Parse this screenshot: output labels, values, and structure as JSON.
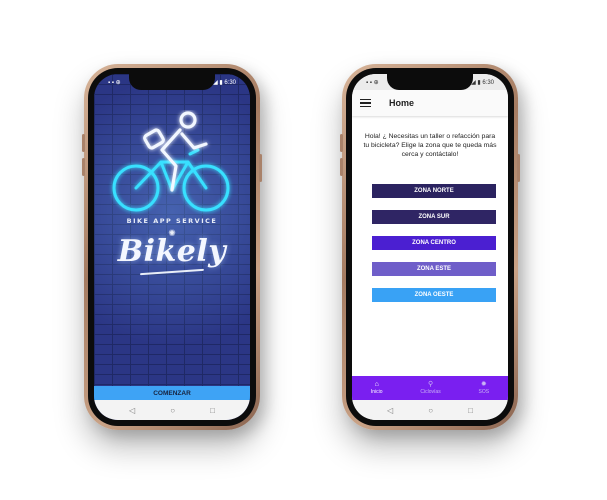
{
  "left_screen": {
    "status": {
      "left": "▪ ▪ ⊕",
      "right": "✱ ⌔ ◢ ▮ 6:30"
    },
    "tagline": "BIKE APP SERVICE",
    "brand": "Bikely",
    "start_button": "COMENZAR",
    "nav": {
      "back": "◁",
      "home": "○",
      "recent": "□"
    }
  },
  "right_screen": {
    "status": {
      "left": "▪ ▪ ⊕",
      "right": "✱ ⌔ ◢ ▮ 6:30"
    },
    "title": "Home",
    "intro": "Hola! ¿ Necesitas un taller o refacción para tu bicicleta? Elige la zona que te queda más cerca y contáctalo!",
    "zones": [
      {
        "label": "ZONA NORTE",
        "color": "#2b2360"
      },
      {
        "label": "ZONA SUR",
        "color": "#2f2564"
      },
      {
        "label": "ZONA CENTRO",
        "color": "#4b1fd1"
      },
      {
        "label": "ZONA ESTE",
        "color": "#6f5ec9"
      },
      {
        "label": "ZONA OESTE",
        "color": "#39a2f5"
      }
    ],
    "bottom_nav": [
      {
        "label": "Inicio",
        "icon": "home-icon",
        "active": true
      },
      {
        "label": "Ciclovías",
        "icon": "bike-icon",
        "active": false
      },
      {
        "label": "SOS",
        "icon": "alert-icon",
        "active": false
      }
    ],
    "nav": {
      "back": "◁",
      "home": "○",
      "recent": "□"
    }
  },
  "colors": {
    "primary_purple": "#7a1ff0",
    "start_blue": "#3ea3f5",
    "neon_cyan": "#38e0ff",
    "brick_blue": "#2b3685"
  }
}
